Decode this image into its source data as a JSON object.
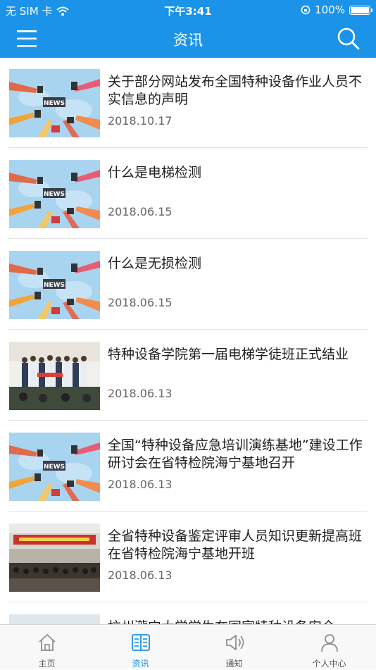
{
  "status_bar": {
    "carrier": "无 SIM 卡",
    "time": "下午3:41",
    "battery": "100%",
    "battery_level": 1.0
  },
  "header": {
    "title": "资讯"
  },
  "articles": [
    {
      "title": "关于部分网站发布全国特种设备作业人员不实信息的声明",
      "date": "2018.10.17",
      "thumb": "news-graphic"
    },
    {
      "title": "什么是电梯检测",
      "date": "2018.06.15",
      "thumb": "news-graphic"
    },
    {
      "title": "什么是无损检测",
      "date": "2018.06.15",
      "thumb": "news-graphic"
    },
    {
      "title": "特种设备学院第一届电梯学徒班正式结业",
      "date": "2018.06.13",
      "thumb": "group-photo"
    },
    {
      "title": "全国“特种设备应急培训演练基地”建设工作研讨会在省特检院海宁基地召开",
      "date": "2018.06.13",
      "thumb": "news-graphic"
    },
    {
      "title": "全省特种设备鉴定评审人员知识更新提高班在省特检院海宁基地开班",
      "date": "2018.06.13",
      "thumb": "meeting-photo"
    },
    {
      "title": "杭州瀧宁大学学生在国家特种设备安全",
      "date": "",
      "thumb": "building-photo"
    }
  ],
  "tabs": [
    {
      "label": "主页",
      "icon": "home-icon",
      "active": false
    },
    {
      "label": "资讯",
      "icon": "news-book-icon",
      "active": true
    },
    {
      "label": "通知",
      "icon": "speaker-icon",
      "active": false
    },
    {
      "label": "个人中心",
      "icon": "person-icon",
      "active": false
    }
  ],
  "colors": {
    "accent": "#1a93e8",
    "tab_inactive": "#8e8e8e"
  }
}
